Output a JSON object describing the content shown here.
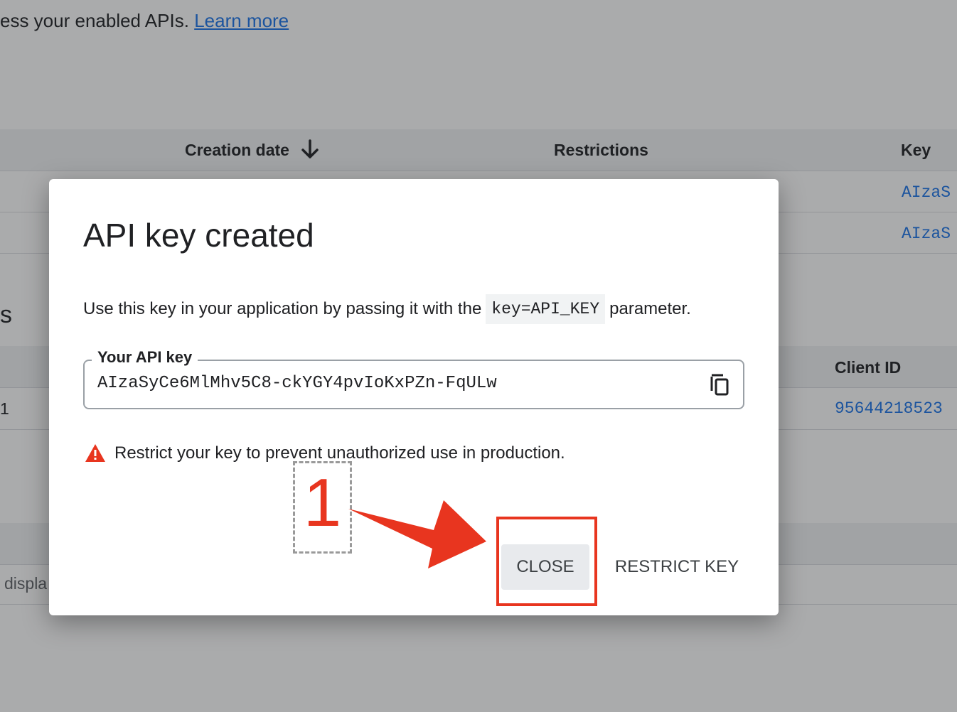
{
  "background": {
    "intro_text": "ess your enabled APIs.",
    "learn_more": "Learn more",
    "api_keys_table": {
      "headers": [
        "Creation date",
        "Restrictions",
        "Key"
      ],
      "rows": [
        {
          "key": "AIzaS"
        },
        {
          "key": "AIzaS"
        }
      ]
    },
    "section_fragment": "s",
    "oauth_table": {
      "client_id_header": "Client ID",
      "row_left": "1",
      "client_id_value": "95644218523"
    },
    "footer_fragment": "displa",
    "sort_icon": "arrow-down-icon"
  },
  "dialog": {
    "title": "API key created",
    "description_before": "Use this key in your application by passing it with the",
    "description_code": "key=API_KEY",
    "description_after": "parameter.",
    "field_label": "Your API key",
    "api_key_value": "AIzaSyCe6MlMhv5C8-ckYGY4pvIoKxPZn-FqULw",
    "copy_icon": "copy-icon",
    "warning_icon": "warning-icon",
    "warning_text": "Restrict your key to prevent unauthorized use in production.",
    "close_label": "CLOSE",
    "restrict_label": "RESTRICT KEY"
  },
  "annotation": {
    "step_number": "1",
    "color": "#e8351f"
  }
}
